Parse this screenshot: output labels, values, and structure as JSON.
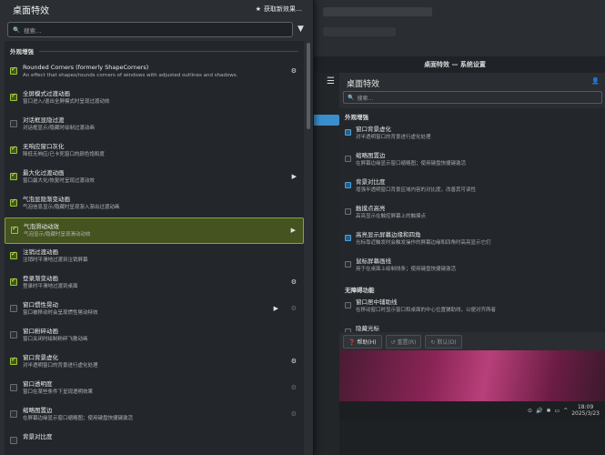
{
  "left_window": {
    "title": "桌面特效",
    "get_new_label": "获取新效果…",
    "search_placeholder": "搜索…",
    "section_appearance": "外观增强",
    "items": [
      {
        "title": "Rounded Corners (formerly ShapeCorners)",
        "desc": "An effect that shapes/rounds corners of windows with adjusted outlines and shadows.",
        "checked": true,
        "gear": true,
        "video": false,
        "gear_dim": false
      },
      {
        "title": "全屏模式过渡动画",
        "desc": "窗口进入/退出全屏模式时呈现过渡动效",
        "checked": true,
        "gear": false,
        "video": false
      },
      {
        "title": "对话框显隐过渡",
        "desc": "对话框显示/隐藏时绘制过渡动画",
        "checked": false,
        "gear": false,
        "video": false
      },
      {
        "title": "无响应窗口灰化",
        "desc": "降低无响应/已卡死窗口的颜色饱和度",
        "checked": true,
        "gear": false,
        "video": false
      },
      {
        "title": "最大化过渡动画",
        "desc": "窗口最大化/恢复时呈现过渡动效",
        "checked": true,
        "gear": false,
        "video": true
      },
      {
        "title": "气泡显隐渐变动画",
        "desc": "气泡信息显示/隐藏时呈现渐入渐出过渡动画",
        "checked": true,
        "gear": false,
        "video": false
      },
      {
        "title": "气泡滑动动效",
        "desc": "气泡显示/隐藏时呈现滑动动效",
        "checked": true,
        "gear": false,
        "video": true,
        "selected": true
      },
      {
        "title": "注销过渡动画",
        "desc": "注销时平滑地过渡到注销屏幕",
        "checked": true,
        "gear": false,
        "video": false
      },
      {
        "title": "登录渐变动画",
        "desc": "登录时平滑地过渡到桌面",
        "checked": true,
        "gear": true,
        "video": false
      },
      {
        "title": "窗口惯性晃动",
        "desc": "窗口被移动时会呈现惯性晃动特效",
        "checked": false,
        "gear": true,
        "gear_dim": true,
        "video": true
      },
      {
        "title": "窗口粉碎动画",
        "desc": "窗口关闭时绘制粉碎飞散动画",
        "checked": false,
        "gear": false,
        "video": false
      },
      {
        "title": "窗口背景虚化",
        "desc": "对半透明窗口的背景进行虚化处理",
        "checked": true,
        "gear": true,
        "video": false
      },
      {
        "title": "窗口透明度",
        "desc": "窗口在某些条件下呈现透明效果",
        "checked": false,
        "gear": true,
        "gear_dim": true,
        "video": false
      },
      {
        "title": "缩略图置边",
        "desc": "在屏幕边缘显示窗口缩略图；使用键盘快捷键激活",
        "checked": false,
        "gear": true,
        "gear_dim": true,
        "video": false
      },
      {
        "title": "背景对比度",
        "desc": "",
        "checked": false,
        "gear": false,
        "video": false
      }
    ]
  },
  "right_window": {
    "window_title": "桌面特效 — 系统设置",
    "header_title": "桌面特效",
    "search_placeholder": "搜索…",
    "section_appearance": "外观增强",
    "section_accessibility": "无障碍功能",
    "items": [
      {
        "title": "窗口背景虚化",
        "desc": "对半透明窗口的背景进行虚化处理",
        "checked": true
      },
      {
        "title": "缩略图置边",
        "desc": "在屏幕边缘显示窗口缩略图；使用键盘快捷键激活",
        "checked": false
      },
      {
        "title": "背景对比度",
        "desc": "增强半透明窗口背景区域内容的对比度，改善其可读性",
        "checked": true
      },
      {
        "title": "触摸点高亮",
        "desc": "高亮显示在触控屏幕上的触摸点",
        "checked": false
      },
      {
        "title": "高亮显示屏幕边缘和四角",
        "desc": "光标靠近触发时会触发操作的屏幕边缘和四角时高亮显示它们",
        "checked": true
      },
      {
        "title": "鼠标屏幕画线",
        "desc": "用于在桌面上绘制线条；使用键盘快捷键激活",
        "checked": false
      }
    ],
    "access_items": [
      {
        "title": "窗口居中辅助线",
        "desc": "在移动窗口时显示窗口和桌面的中心位置辅助线，以便对齐两者",
        "checked": false
      },
      {
        "title": "隐藏光标",
        "desc": "闲置或者键盘输入时隐藏鼠标光标",
        "checked": false
      }
    ],
    "help_label": "帮助(H)",
    "reset_label": "重置(R)",
    "default_label": "默认(D)",
    "clock_time": "18:09",
    "clock_date": "2025/3/23"
  }
}
